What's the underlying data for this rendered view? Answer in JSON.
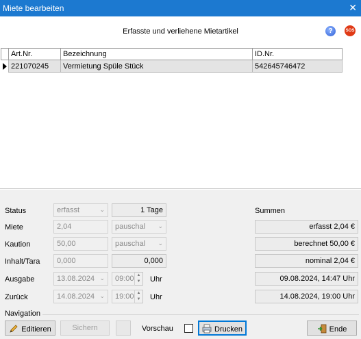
{
  "window": {
    "title": "Miete bearbeiten",
    "close_glyph": "✕"
  },
  "header": {
    "heading": "Erfasste und verliehene Mietartikel",
    "help_icon": "?",
    "sos_icon": "SOS"
  },
  "table": {
    "columns": [
      "Art.Nr.",
      "Bezeichnung",
      "ID.Nr."
    ],
    "rows": [
      [
        "221070245",
        "Vermietung Spüle Stück",
        "542645746472"
      ]
    ]
  },
  "form": {
    "status": {
      "label": "Status",
      "value": "erfasst",
      "days": "1 Tage"
    },
    "miete": {
      "label": "Miete",
      "value": "2,04",
      "type": "pauschal"
    },
    "kaution": {
      "label": "Kaution",
      "value": "50,00",
      "type": "pauschal"
    },
    "inhalt": {
      "label": "Inhalt/Tara",
      "value": "0,000",
      "value2": "0,000"
    },
    "ausgabe": {
      "label": "Ausgabe",
      "date": "13.08.2024",
      "time": "09:00",
      "unit": "Uhr"
    },
    "zurueck": {
      "label": "Zurück",
      "date": "14.08.2024",
      "time": "19:00",
      "unit": "Uhr"
    }
  },
  "summen": {
    "title": "Summen",
    "erfasst": "erfasst 2,04 €",
    "berechnet": "berechnet 50,00 €",
    "nominal": "nominal 2,04 €",
    "ausgabe": "09.08.2024, 14:47 Uhr",
    "zurueck": "14.08.2024, 19:00 Uhr"
  },
  "navigation": {
    "title": "Navigation",
    "edit": "Editieren",
    "save": "Sichern",
    "preview": "Vorschau",
    "print": "Drucken",
    "end": "Ende"
  }
}
